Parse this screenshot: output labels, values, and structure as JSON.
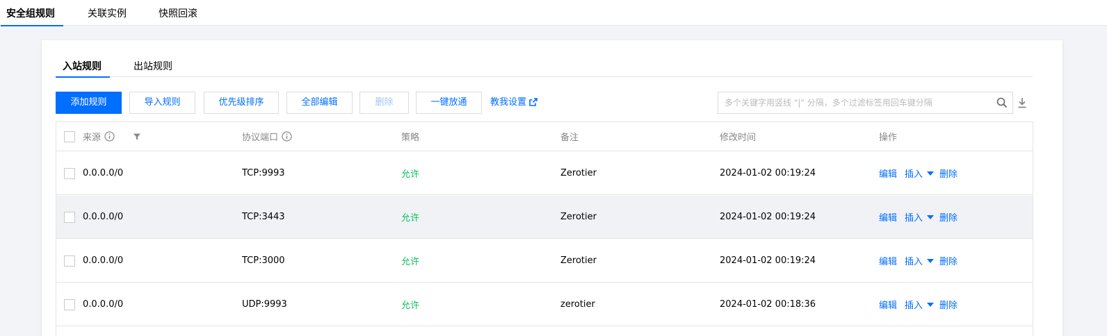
{
  "top_tabs": [
    "安全组规则",
    "关联实例",
    "快照回滚"
  ],
  "sub_tabs": [
    "入站规则",
    "出站规则"
  ],
  "toolbar": {
    "add": "添加规则",
    "import": "导入规则",
    "priority": "优先级排序",
    "edit_all": "全部编辑",
    "delete": "删除",
    "open_all": "一键放通",
    "help": "教我设置"
  },
  "search": {
    "placeholder": "多个关键字用竖线 \"|\" 分隔，多个过滤标签用回车键分隔"
  },
  "table": {
    "headers": {
      "source": "来源",
      "protocol_port": "协议端口",
      "policy": "策略",
      "remark": "备注",
      "modified": "修改时间",
      "actions": "操作"
    },
    "rows": [
      {
        "source": "0.0.0.0/0",
        "port": "TCP:9993",
        "policy": "允许",
        "remark": "Zerotier",
        "modified": "2024-01-02 00:19:24"
      },
      {
        "source": "0.0.0.0/0",
        "port": "TCP:3443",
        "policy": "允许",
        "remark": "Zerotier",
        "modified": "2024-01-02 00:19:24"
      },
      {
        "source": "0.0.0.0/0",
        "port": "TCP:3000",
        "policy": "允许",
        "remark": "Zerotier",
        "modified": "2024-01-02 00:19:24"
      },
      {
        "source": "0.0.0.0/0",
        "port": "UDP:9993",
        "policy": "允许",
        "remark": "zerotier",
        "modified": "2024-01-02 00:18:36"
      }
    ],
    "row_actions": {
      "edit": "编辑",
      "insert": "插入",
      "delete": "删除"
    }
  },
  "colors": {
    "accent": "#006eff",
    "allow": "#0abf5b"
  }
}
